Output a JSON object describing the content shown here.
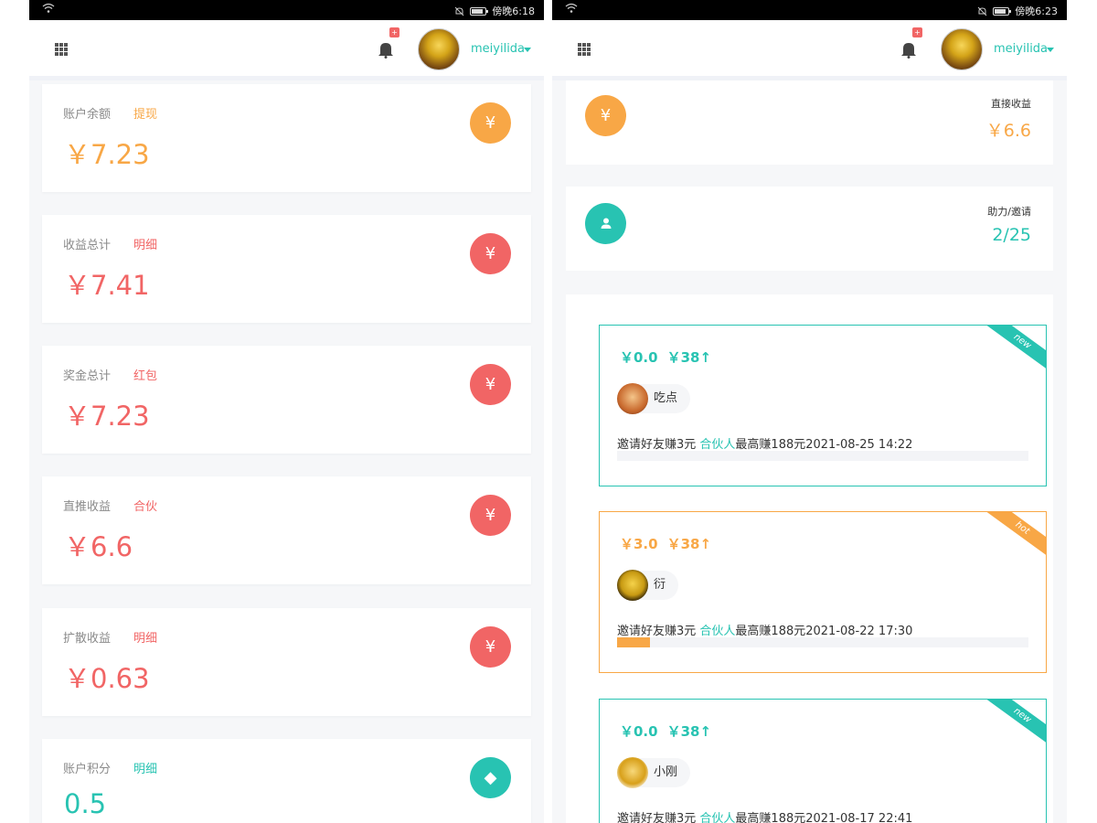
{
  "colors": {
    "teal": "#28c3b2",
    "orange": "#f8a746",
    "red": "#f16565"
  },
  "left": {
    "status": {
      "time": "傍晚6:18"
    },
    "header": {
      "username": "meiyilida",
      "bell_badge": "+"
    },
    "stats": [
      {
        "label": "账户余额",
        "link": "提现",
        "value": "￥7.23",
        "icon": "yen-icon",
        "icon_glyph": "¥",
        "color": "#f8a746",
        "link_color": "#f8a746"
      },
      {
        "label": "收益总计",
        "link": "明细",
        "value": "￥7.41",
        "icon": "yen-icon",
        "icon_glyph": "¥",
        "color": "#f16565",
        "link_color": "#f16565"
      },
      {
        "label": "奖金总计",
        "link": "红包",
        "value": "￥7.23",
        "icon": "yen-icon",
        "icon_glyph": "¥",
        "color": "#f16565",
        "link_color": "#f16565"
      },
      {
        "label": "直推收益",
        "link": "合伙",
        "value": "￥6.6",
        "icon": "yen-icon",
        "icon_glyph": "¥",
        "color": "#f16565",
        "link_color": "#f16565"
      },
      {
        "label": "扩散收益",
        "link": "明细",
        "value": "￥0.63",
        "icon": "yen-icon",
        "icon_glyph": "¥",
        "color": "#f16565",
        "link_color": "#f16565"
      },
      {
        "label": "账户积分",
        "link": "明细",
        "value": "0.5",
        "icon": "diamond-icon",
        "icon_glyph": "◆",
        "color": "#28c3b2",
        "link_color": "#28c3b2"
      }
    ]
  },
  "right": {
    "status": {
      "time": "傍晚6:23"
    },
    "header": {
      "username": "meiyilida",
      "bell_badge": "+"
    },
    "info": [
      {
        "label": "直接收益",
        "value": "￥6.6",
        "icon": "yen-icon",
        "color": "#f8a746"
      },
      {
        "label": "助力/邀请",
        "value": "2/25",
        "icon": "user-icon",
        "color": "#28c3b2"
      }
    ],
    "tasks": [
      {
        "tag": "new",
        "price": "￥0.0",
        "max": "￥38↑",
        "name": "吃点",
        "desc_pre": "邀请好友赚3元 ",
        "desc_partner": "合伙人",
        "desc_post": "最高赚188元2021-08-25 14:22",
        "progress": 0,
        "color": "#28c3b2"
      },
      {
        "tag": "hot",
        "price": "￥3.0",
        "max": "￥38↑",
        "name": "衍",
        "desc_pre": "邀请好友赚3元 ",
        "desc_partner": "合伙人",
        "desc_post": "最高赚188元2021-08-22 17:30",
        "progress": 0.08,
        "color": "#f8a746"
      },
      {
        "tag": "new",
        "price": "￥0.0",
        "max": "￥38↑",
        "name": "小刚",
        "desc_pre": "邀请好友赚3元 ",
        "desc_partner": "合伙人",
        "desc_post": "最高赚188元2021-08-17 22:41",
        "progress": 0,
        "color": "#28c3b2"
      }
    ]
  }
}
